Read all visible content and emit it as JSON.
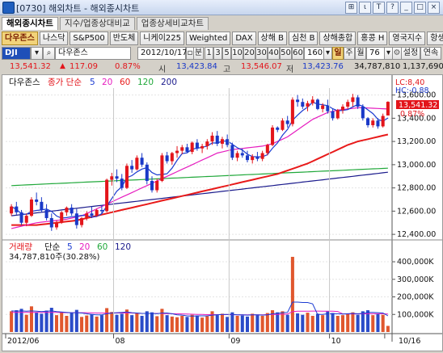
{
  "window": {
    "title": "[0730] 해외차트 - 해외종시차트",
    "buttons": [
      "⊞",
      "ι",
      "T",
      "?",
      "_",
      "□",
      "×"
    ]
  },
  "tabs": [
    "해외종시차트",
    "지수/업종상대비교",
    "업종상세비교차트"
  ],
  "markets": [
    "다우존스",
    "나스닥",
    "S&P500",
    "반도체",
    "니케이225",
    "Weighted",
    "DAX",
    "상해 B",
    "심천 B",
    "상해종합",
    "홍콩 H",
    "영국지수",
    "항생지수"
  ],
  "toolbar": {
    "code": "DJI",
    "name": "다우존스",
    "date": "2012/10/17",
    "period_unit": "분",
    "minute_options": [
      "1",
      "3",
      "5",
      "10",
      "20",
      "30",
      "40",
      "50",
      "60"
    ],
    "count": "160",
    "interval_options": [
      "일",
      "주",
      "월"
    ],
    "active_interval": "일",
    "span": "76",
    "settings": "설정",
    "continuous": "연속"
  },
  "quote": {
    "last": "13,541.32",
    "change_arrow": "▲",
    "change": "117.09",
    "change_pct": "0.87%",
    "open_label": "시",
    "open": "13,423.84",
    "high_label": "고",
    "high": "13,546.07",
    "low_label": "저",
    "low": "13,423.76",
    "volume": "34,787,810",
    "prev_volume": "1,137,690"
  },
  "price_panel": {
    "name": "다우존스",
    "legend_title": "종가 단순",
    "ma_periods": [
      "5",
      "20",
      "60",
      "120",
      "200"
    ],
    "ma_colors": [
      "#1b3bd1",
      "#e61cbf",
      "#e81a1a",
      "#20a83a",
      "#1a1a8c"
    ],
    "lc": "LC:8,40",
    "hc": "HC:-0.88",
    "last_tag": "13,541.32",
    "last_pct": "0.87%",
    "y_ticks": [
      "13,600.00",
      "13,400.00",
      "13,200.00",
      "13,000.00",
      "12,800.00",
      "12,600.00",
      "12,400.00"
    ]
  },
  "volume_panel": {
    "title": "거래량",
    "legend_title": "단순",
    "ma_periods": [
      "5",
      "20",
      "60",
      "120"
    ],
    "info": "34,787,810주(30.28%)",
    "y_ticks": [
      "400,000K",
      "300,000K",
      "200,000K",
      "100,000K"
    ]
  },
  "x_axis": [
    "2012/06",
    "08",
    "09",
    "10",
    "10/16"
  ],
  "chart_data": [
    {
      "type": "candlestick",
      "title": "다우존스",
      "ylim": [
        12380,
        13660
      ],
      "y_ticks": [
        12400,
        12600,
        12800,
        13000,
        13200,
        13400,
        13600
      ],
      "x_labels": [
        "2012/06",
        "08",
        "09",
        "10",
        "10/16"
      ],
      "candles": [
        [
          12580,
          12660,
          12560,
          12640
        ],
        [
          12640,
          12680,
          12570,
          12590
        ],
        [
          12590,
          12610,
          12480,
          12500
        ],
        [
          12500,
          12580,
          12470,
          12560
        ],
        [
          12560,
          12720,
          12550,
          12700
        ],
        [
          12700,
          12760,
          12650,
          12680
        ],
        [
          12680,
          12720,
          12590,
          12610
        ],
        [
          12610,
          12660,
          12520,
          12540
        ],
        [
          12540,
          12580,
          12430,
          12460
        ],
        [
          12460,
          12520,
          12440,
          12500
        ],
        [
          12500,
          12600,
          12490,
          12590
        ],
        [
          12590,
          12640,
          12560,
          12630
        ],
        [
          12630,
          12660,
          12560,
          12580
        ],
        [
          12580,
          12620,
          12450,
          12480
        ],
        [
          12480,
          12550,
          12460,
          12540
        ],
        [
          12540,
          12600,
          12520,
          12580
        ],
        [
          12580,
          12640,
          12540,
          12560
        ],
        [
          12560,
          12620,
          12550,
          12610
        ],
        [
          12610,
          12650,
          12580,
          12600
        ],
        [
          12600,
          12880,
          12590,
          12870
        ],
        [
          12870,
          12930,
          12820,
          12900
        ],
        [
          12900,
          12960,
          12850,
          12880
        ],
        [
          12880,
          12920,
          12780,
          12800
        ],
        [
          12800,
          13010,
          12790,
          12990
        ],
        [
          12990,
          13040,
          12930,
          12960
        ],
        [
          12960,
          13080,
          12950,
          13060
        ],
        [
          13060,
          13100,
          12980,
          13000
        ],
        [
          13000,
          13020,
          12830,
          12860
        ],
        [
          12860,
          12900,
          12760,
          12780
        ],
        [
          12780,
          12880,
          12760,
          12860
        ],
        [
          12860,
          13100,
          12850,
          13080
        ],
        [
          13080,
          13110,
          13010,
          13030
        ],
        [
          13030,
          13110,
          13000,
          13100
        ],
        [
          13100,
          13160,
          13060,
          13120
        ],
        [
          13120,
          13170,
          13090,
          13150
        ],
        [
          13150,
          13180,
          13100,
          13110
        ],
        [
          13110,
          13200,
          13090,
          13190
        ],
        [
          13190,
          13220,
          13120,
          13140
        ],
        [
          13140,
          13180,
          13100,
          13160
        ],
        [
          13160,
          13220,
          13130,
          13200
        ],
        [
          13200,
          13280,
          13170,
          13250
        ],
        [
          13250,
          13290,
          13160,
          13180
        ],
        [
          13180,
          13240,
          13140,
          13220
        ],
        [
          13220,
          13260,
          13150,
          13170
        ],
        [
          13170,
          13190,
          13040,
          13060
        ],
        [
          13060,
          13120,
          13030,
          13100
        ],
        [
          13100,
          13140,
          13060,
          13080
        ],
        [
          13080,
          13120,
          13020,
          13040
        ],
        [
          13040,
          13090,
          13010,
          13070
        ],
        [
          13070,
          13110,
          13030,
          13050
        ],
        [
          13050,
          13120,
          13030,
          13100
        ],
        [
          13100,
          13180,
          13080,
          13170
        ],
        [
          13170,
          13340,
          13160,
          13320
        ],
        [
          13320,
          13330,
          13280,
          13300
        ],
        [
          13300,
          13400,
          13290,
          13380
        ],
        [
          13380,
          13420,
          13320,
          13350
        ],
        [
          13350,
          13580,
          13330,
          13560
        ],
        [
          13560,
          13600,
          13500,
          13540
        ],
        [
          13540,
          13570,
          13480,
          13500
        ],
        [
          13500,
          13550,
          13460,
          13530
        ],
        [
          13530,
          13590,
          13510,
          13560
        ],
        [
          13560,
          13570,
          13470,
          13480
        ],
        [
          13480,
          13530,
          13450,
          13510
        ],
        [
          13510,
          13560,
          13440,
          13460
        ],
        [
          13460,
          13480,
          13380,
          13400
        ],
        [
          13400,
          13480,
          13390,
          13470
        ],
        [
          13470,
          13520,
          13440,
          13500
        ],
        [
          13500,
          13560,
          13480,
          13540
        ],
        [
          13540,
          13610,
          13500,
          13580
        ],
        [
          13580,
          13600,
          13480,
          13500
        ],
        [
          13500,
          13520,
          13380,
          13400
        ],
        [
          13400,
          13410,
          13320,
          13340
        ],
        [
          13340,
          13400,
          13320,
          13380
        ],
        [
          13380,
          13400,
          13310,
          13330
        ],
        [
          13330,
          13440,
          13320,
          13420
        ],
        [
          13423.84,
          13546.07,
          13423.76,
          13541.32
        ]
      ],
      "ma_20": [
        12450,
        12460,
        12470,
        12480,
        12490,
        12500,
        12505,
        12510,
        12515,
        12520,
        12525,
        12530,
        12540,
        12550,
        12560,
        12580,
        12600,
        12620,
        12640,
        12660,
        12680,
        12700,
        12720,
        12740,
        12760,
        12780,
        12800,
        12820,
        12840,
        12860,
        12880,
        12900,
        12920,
        12940,
        12960,
        12980,
        13000,
        13020,
        13040,
        13060,
        13080,
        13100,
        13110,
        13120,
        13130,
        13135,
        13140,
        13145,
        13150,
        13155,
        13160,
        13170,
        13180,
        13200,
        13220,
        13240,
        13270,
        13300,
        13330,
        13360,
        13390,
        13410,
        13430,
        13450,
        13460,
        13470,
        13475,
        13480,
        13485,
        13490,
        13490,
        13488,
        13486,
        13484,
        13482,
        13480
      ],
      "ma_60": [
        12480,
        12480,
        12480,
        12480,
        12480,
        12480,
        12485,
        12490,
        12495,
        12500,
        12505,
        12510,
        12515,
        12520,
        12530,
        12540,
        12550,
        12560,
        12570,
        12580,
        12590,
        12600,
        12610,
        12620,
        12630,
        12640,
        12650,
        12660,
        12670,
        12680,
        12690,
        12700,
        12710,
        12720,
        12730,
        12740,
        12750,
        12760,
        12770,
        12780,
        12790,
        12800,
        12810,
        12820,
        12830,
        12840,
        12850,
        12860,
        12870,
        12880,
        12890,
        12900,
        12910,
        12920,
        12935,
        12950,
        12965,
        12980,
        12995,
        13010,
        13030,
        13050,
        13070,
        13090,
        13110,
        13130,
        13150,
        13170,
        13185,
        13200,
        13210,
        13220,
        13230,
        13240,
        13250,
        13260
      ],
      "ma_120": [
        12820,
        12822,
        12824,
        12826,
        12828,
        12830,
        12832,
        12834,
        12836,
        12838,
        12840,
        12842,
        12844,
        12846,
        12848,
        12850,
        12852,
        12854,
        12856,
        12858,
        12860,
        12862,
        12864,
        12866,
        12868,
        12870,
        12872,
        12874,
        12876,
        12878,
        12880,
        12882,
        12884,
        12886,
        12888,
        12890,
        12892,
        12894,
        12896,
        12898,
        12900,
        12902,
        12904,
        12906,
        12908,
        12910,
        12912,
        12914,
        12916,
        12918,
        12920,
        12922,
        12924,
        12926,
        12928,
        12930,
        12932,
        12934,
        12936,
        12938,
        12940,
        12942,
        12944,
        12946,
        12948,
        12950,
        12952,
        12954,
        12956,
        12958,
        12960,
        12962,
        12964,
        12966,
        12968,
        12970
      ],
      "ma_200": [
        12560,
        12565,
        12570,
        12575,
        12580,
        12585,
        12590,
        12595,
        12600,
        12605,
        12610,
        12615,
        12620,
        12625,
        12630,
        12635,
        12640,
        12645,
        12650,
        12655,
        12660,
        12665,
        12670,
        12675,
        12680,
        12685,
        12690,
        12695,
        12700,
        12705,
        12710,
        12715,
        12720,
        12725,
        12730,
        12735,
        12740,
        12745,
        12750,
        12755,
        12760,
        12765,
        12770,
        12775,
        12780,
        12785,
        12790,
        12795,
        12800,
        12805,
        12810,
        12815,
        12820,
        12825,
        12830,
        12835,
        12840,
        12845,
        12850,
        12855,
        12860,
        12865,
        12870,
        12875,
        12880,
        12885,
        12890,
        12895,
        12900,
        12905,
        12910,
        12915,
        12920,
        12925,
        12930,
        12935
      ]
    },
    {
      "type": "bar",
      "title": "거래량",
      "ylim": [
        0,
        460000
      ],
      "unit": "K",
      "y_ticks": [
        100000,
        200000,
        300000,
        400000
      ],
      "values": [
        118000,
        124000,
        132000,
        98000,
        146000,
        110000,
        104000,
        122000,
        138000,
        96000,
        112000,
        92000,
        108000,
        126000,
        86000,
        94000,
        102000,
        88000,
        96000,
        136000,
        114000,
        98000,
        104000,
        128000,
        96000,
        108000,
        92000,
        118000,
        112000,
        90000,
        132000,
        96000,
        88000,
        84000,
        92000,
        86000,
        98000,
        94000,
        82000,
        90000,
        118000,
        96000,
        104000,
        86000,
        112000,
        92000,
        94000,
        88000,
        104000,
        96000,
        92000,
        108000,
        124000,
        112000,
        118000,
        98000,
        428000,
        106000,
        98000,
        110000,
        92000,
        104000,
        96000,
        118000,
        108000,
        92000,
        96000,
        104000,
        112000,
        98000,
        118000,
        124000,
        96000,
        102000,
        98000,
        34788
      ],
      "ma_5": [
        120000,
        118000,
        120000,
        118000,
        120000,
        118000,
        116000,
        118000,
        120000,
        116000,
        114000,
        112000,
        110000,
        110000,
        108000,
        104000,
        100000,
        98000,
        98000,
        104000,
        108000,
        110000,
        112000,
        114000,
        110000,
        108000,
        106000,
        106000,
        106000,
        104000,
        108000,
        108000,
        104000,
        98000,
        96000,
        92000,
        90000,
        92000,
        92000,
        92000,
        96000,
        98000,
        100000,
        100000,
        100000,
        98000,
        98000,
        96000,
        98000,
        98000,
        96000,
        98000,
        104000,
        106000,
        110000,
        112000,
        170000,
        170000,
        168000,
        168000,
        160000,
        100000,
        100000,
        104000,
        104000,
        104000,
        102000,
        104000,
        106000,
        104000,
        106000,
        112000,
        112000,
        110000,
        108000,
        92000
      ],
      "ma_20": [
        112000,
        112000,
        112000,
        112000,
        112000,
        112000,
        112000,
        112000,
        112000,
        112000,
        111000,
        110000,
        110000,
        110000,
        110000,
        110000,
        109000,
        108000,
        108000,
        108000,
        108000,
        108000,
        108000,
        108000,
        108000,
        107000,
        106000,
        106000,
        106000,
        106000,
        106000,
        105000,
        104000,
        104000,
        103000,
        102000,
        101000,
        100000,
        100000,
        99000,
        99000,
        99000,
        99000,
        99000,
        99000,
        98000,
        98000,
        98000,
        98000,
        98000,
        98000,
        99000,
        100000,
        100000,
        101000,
        102000,
        116000,
        118000,
        118000,
        118000,
        119000,
        119000,
        118000,
        118000,
        118000,
        117000,
        103000,
        103000,
        103000,
        103000,
        104000,
        104000,
        104000,
        104000,
        104000,
        102000
      ]
    }
  ]
}
